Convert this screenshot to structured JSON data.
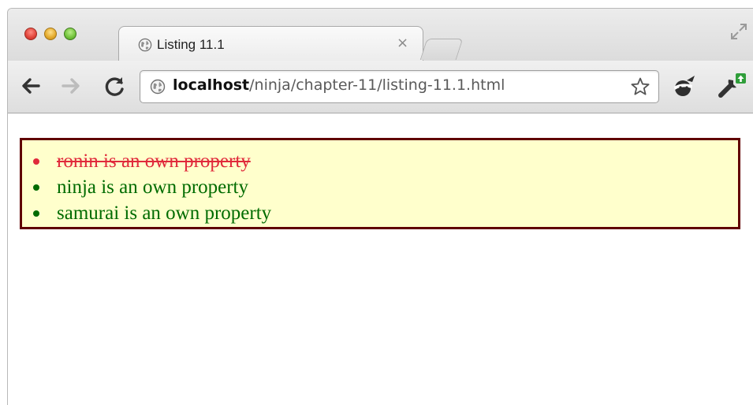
{
  "browser": {
    "tab": {
      "title": "Listing 11.1",
      "close_glyph": "×",
      "favicon": "globe-icon"
    },
    "toolbar": {
      "back_icon": "back-arrow-icon",
      "forward_icon": "forward-arrow-icon",
      "reload_icon": "reload-icon"
    },
    "address_bar": {
      "host": "localhost",
      "path": "/ninja/chapter-11/listing-11.1.html",
      "bookmark_icon": "star-icon"
    },
    "extensions": [
      "ninja-extension-icon",
      "wrench-update-icon"
    ]
  },
  "results": {
    "items": [
      {
        "text": "ronin is an own property",
        "status": "fail"
      },
      {
        "text": "ninja is an own property",
        "status": "pass"
      },
      {
        "text": "samurai is an own property",
        "status": "pass"
      }
    ]
  },
  "colors": {
    "fail": "#e02a3b",
    "pass": "#006b00",
    "results_background": "#ffffcc",
    "results_border": "#600000"
  }
}
